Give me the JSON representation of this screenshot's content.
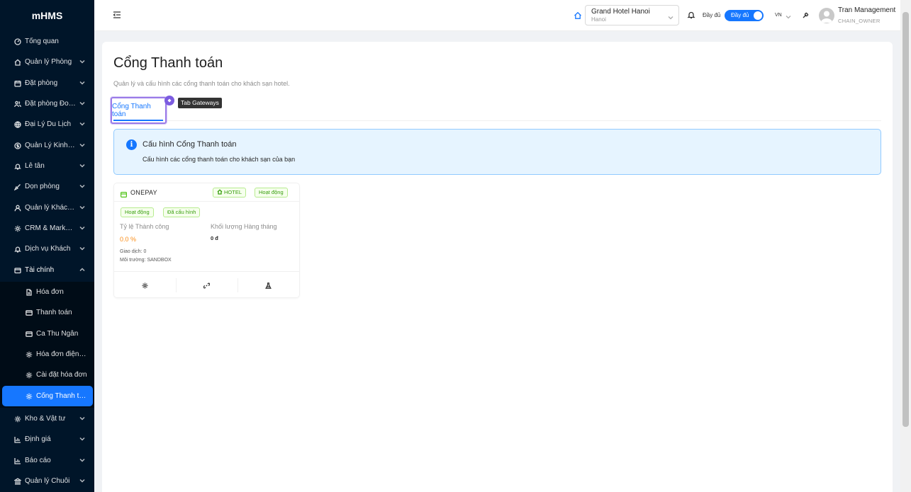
{
  "app": {
    "logo": "mHMS"
  },
  "sidebar": {
    "items": [
      {
        "label": "Tổng quan",
        "icon": "dashboard-icon",
        "has_children": false
      },
      {
        "label": "Quản lý Phòng",
        "icon": "home-icon",
        "has_children": true
      },
      {
        "label": "Đặt phòng",
        "icon": "calendar-icon",
        "has_children": true
      },
      {
        "label": "Đặt phòng Đoàn",
        "icon": "team-icon",
        "has_children": true
      },
      {
        "label": "Đại Lý Du Lịch",
        "icon": "globe-icon",
        "has_children": true
      },
      {
        "label": "Quản Lý Kinh Doanh",
        "icon": "dollar-icon",
        "has_children": true
      },
      {
        "label": "Lễ tân",
        "icon": "bell-icon",
        "has_children": true
      },
      {
        "label": "Dọn phòng",
        "icon": "broom-icon",
        "has_children": true
      },
      {
        "label": "Quản lý Khách hàng",
        "icon": "user-icon",
        "has_children": true
      },
      {
        "label": "CRM & Marketing",
        "icon": "gear-icon",
        "has_children": true
      },
      {
        "label": "Dịch vụ Khách",
        "icon": "bell-icon",
        "has_children": true
      },
      {
        "label": "Tài chính",
        "icon": "wallet-icon",
        "has_children": true,
        "open": true
      }
    ],
    "finance_children": [
      {
        "label": "Hóa đơn",
        "icon": "file-icon"
      },
      {
        "label": "Thanh toán",
        "icon": "card-icon"
      },
      {
        "label": "Ca Thu Ngân",
        "icon": "card-icon"
      },
      {
        "label": "Hóa đơn điện tử",
        "icon": "gear-icon"
      },
      {
        "label": "Cài đặt hóa đơn",
        "icon": "gear-icon"
      },
      {
        "label": "Cổng Thanh toán",
        "icon": "gear-icon",
        "active": true
      }
    ],
    "bottom_items": [
      {
        "label": "Kho & Vật tư",
        "icon": "gear-icon",
        "has_children": true
      },
      {
        "label": "Định giá",
        "icon": "chart-icon",
        "has_children": true
      },
      {
        "label": "Báo cáo",
        "icon": "chart-icon",
        "has_children": true
      },
      {
        "label": "Quản lý Chuỗi",
        "icon": "bank-icon",
        "has_children": true
      }
    ]
  },
  "header": {
    "hotel_name": "Grand Hotel Hanoi",
    "hotel_city": "Hanoi",
    "mode_label": "Đầy đủ",
    "toggle_label": "Đầy đủ",
    "language": "VN",
    "user_name": "Tran Management",
    "user_role": "CHAIN_OWNER"
  },
  "page": {
    "title": "Cổng Thanh toán",
    "description": "Quản lý và cấu hình các cổng thanh toán cho khách sạn hotel.",
    "tab_label": "Cổng Thanh toán",
    "tab_tooltip": "Tab Gateways",
    "alert_title": "Cấu hình Cổng Thanh toán",
    "alert_desc": "Cấu hình các cổng thanh toán cho khách sạn của bạn"
  },
  "gateway": {
    "name": "ONEPAY",
    "scope_tag": "HOTEL",
    "status_tag": "Hoạt động",
    "badge_active": "Hoạt động",
    "badge_configured": "Đã cấu hình",
    "success_rate_label": "Tỷ lệ Thành công",
    "success_rate_value": "0.0 %",
    "monthly_volume_label": "Khối lượng Hàng tháng",
    "monthly_volume_value": "0 đ",
    "transactions": "Giao dịch: 0",
    "environment": "Môi trường: SANDBOX"
  }
}
